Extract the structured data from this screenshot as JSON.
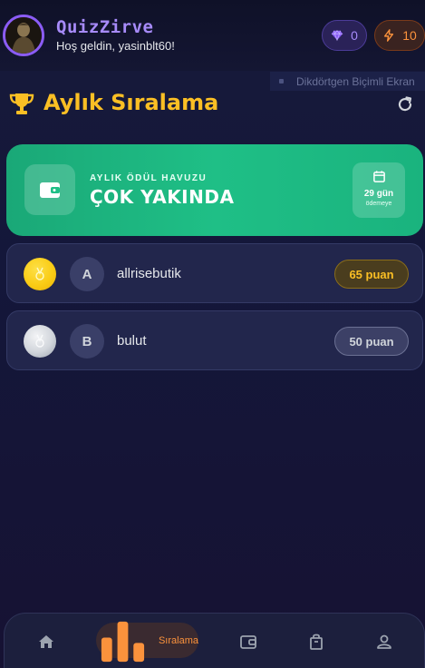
{
  "header": {
    "app_title": "QuizZirve",
    "greeting": "Hoş geldin, yasinblt60!",
    "gems_count": "0",
    "energy_count": "10"
  },
  "overlay": {
    "banner_text": "Dikdörtgen Biçimli Ekran"
  },
  "page": {
    "title": "Aylık Sıralama"
  },
  "prize": {
    "label": "AYLIK ÖDÜL HAVUZU",
    "value": "ÇOK YAKINDA",
    "days": "29 gün",
    "days_sub": "ödemeye"
  },
  "leaderboard": [
    {
      "initial": "A",
      "name": "allrisebutik",
      "score": "65 puan",
      "medal": "gold"
    },
    {
      "initial": "B",
      "name": "bulut",
      "score": "50 puan",
      "medal": "silver"
    }
  ],
  "nav": {
    "active_label": "Sıralama",
    "items": [
      "home-icon",
      "ranking-icon",
      "wallet-icon",
      "shop-bag-icon",
      "profile-icon"
    ]
  },
  "colors": {
    "accent_purple": "#a78bfa",
    "accent_gold": "#fbbf24",
    "accent_orange": "#fb923c",
    "prize_green": "#1fbf86"
  }
}
